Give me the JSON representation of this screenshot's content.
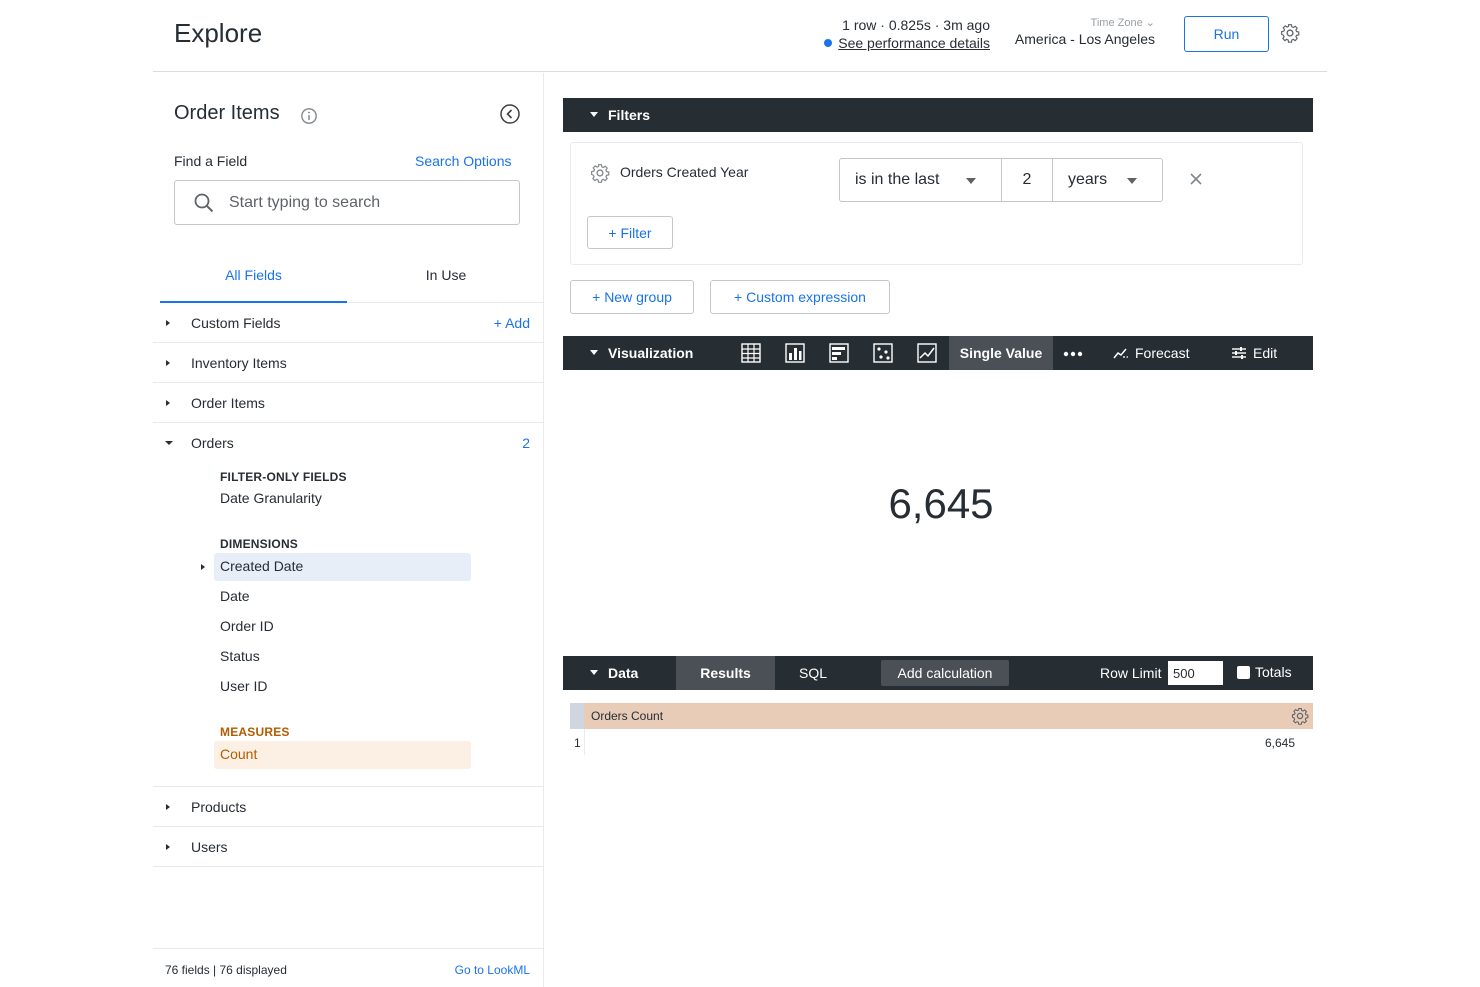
{
  "header": {
    "title": "Explore",
    "stats": "1 row · 0.825s · 3m ago",
    "perf_link": "See performance details",
    "timezone_label": "Time Zone",
    "timezone_value": "America - Los Angeles",
    "run_label": "Run"
  },
  "sidebar": {
    "explore_name": "Order Items",
    "find_label": "Find a Field",
    "search_options": "Search Options",
    "search_placeholder": "Start typing to search",
    "tabs": [
      {
        "label": "All Fields",
        "active": true
      },
      {
        "label": "In Use",
        "active": false
      }
    ],
    "views": [
      {
        "name": "Custom Fields",
        "action": "Add"
      },
      {
        "name": "Inventory Items"
      },
      {
        "name": "Order Items"
      },
      {
        "name": "Orders",
        "count": "2",
        "expanded": true
      },
      {
        "name": "Products"
      },
      {
        "name": "Users"
      }
    ],
    "orders": {
      "filter_only_label": "FILTER-ONLY FIELDS",
      "filter_only_fields": [
        "Date Granularity"
      ],
      "dimensions_label": "DIMENSIONS",
      "dimensions": [
        "Created Date",
        "Date",
        "Order ID",
        "Status",
        "User ID"
      ],
      "measures_label": "MEASURES",
      "measures": [
        "Count"
      ]
    },
    "footer": {
      "field_count": "76 fields | 76 displayed",
      "lookml_link": "Go to LookML"
    }
  },
  "filters": {
    "title": "Filters",
    "field": "Orders Created Year",
    "operator": "is in the last",
    "value": "2",
    "unit": "years",
    "add_filter": "Filter",
    "new_group": "New group",
    "custom_expression": "Custom expression"
  },
  "visualization": {
    "title": "Visualization",
    "active_type": "Single Value",
    "forecast": "Forecast",
    "edit": "Edit",
    "value": "6,645",
    "icons": [
      "table-icon",
      "column-chart-icon",
      "bar-chart-icon",
      "scatter-icon",
      "line-chart-icon"
    ]
  },
  "data": {
    "title": "Data",
    "tabs": [
      "Results",
      "SQL"
    ],
    "add_calculation": "Add calculation",
    "row_limit_label": "Row Limit",
    "row_limit": "500",
    "totals_label": "Totals",
    "columns": [
      "Orders Count"
    ],
    "rows": [
      {
        "index": "1",
        "values": [
          "6,645"
        ]
      }
    ]
  },
  "colors": {
    "accent": "#1a73e8",
    "dark_bar": "#262d33",
    "measure": "#b35c00",
    "measure_header": "#e8ccb8"
  }
}
